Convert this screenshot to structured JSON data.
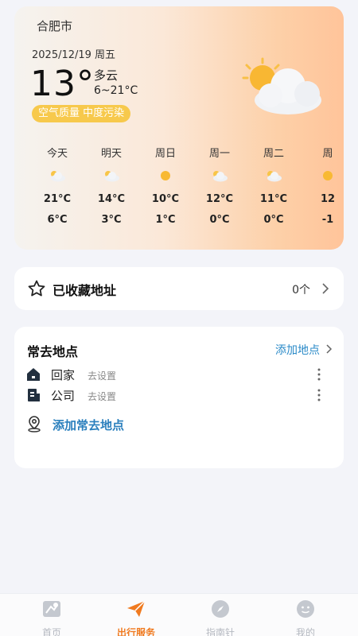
{
  "weather": {
    "city": "合肥市",
    "date": "2025/12/19 周五",
    "current_temp": "13°",
    "condition": "多云",
    "range": "6~21°C",
    "air_quality": "空气质量 中度污染",
    "big_icon": "cloud-sun-icon",
    "forecast": [
      {
        "day": "今天",
        "icon": "cloud-icon",
        "high": "21°C",
        "low": "6°C"
      },
      {
        "day": "明天",
        "icon": "cloud-icon",
        "high": "14°C",
        "low": "3°C"
      },
      {
        "day": "周日",
        "icon": "sun-icon",
        "high": "10°C",
        "low": "1°C"
      },
      {
        "day": "周一",
        "icon": "cloud-icon",
        "high": "12°C",
        "low": "0°C"
      },
      {
        "day": "周二",
        "icon": "cloud-icon",
        "high": "11°C",
        "low": "0°C"
      },
      {
        "day": "周",
        "icon": "sun-icon",
        "high": "12",
        "low": "-1"
      }
    ]
  },
  "favorites": {
    "title": "已收藏地址",
    "count": "0个"
  },
  "places": {
    "title": "常去地点",
    "add_link": "添加地点",
    "items": [
      {
        "name": "回家",
        "status": "去设置",
        "icon": "home-icon"
      },
      {
        "name": "公司",
        "status": "去设置",
        "icon": "office-icon"
      }
    ],
    "add_frequent": "添加常去地点"
  },
  "nav": {
    "items": [
      {
        "label": "首页",
        "icon": "map-icon",
        "active": false
      },
      {
        "label": "出行服务",
        "icon": "paper-plane-icon",
        "active": true
      },
      {
        "label": "指南针",
        "icon": "compass-icon",
        "active": false
      },
      {
        "label": "我的",
        "icon": "face-icon",
        "active": false
      }
    ]
  },
  "colors": {
    "accent": "#f07a1f",
    "link": "#2a8ac8",
    "aqi_badge": "#f7c94c"
  }
}
